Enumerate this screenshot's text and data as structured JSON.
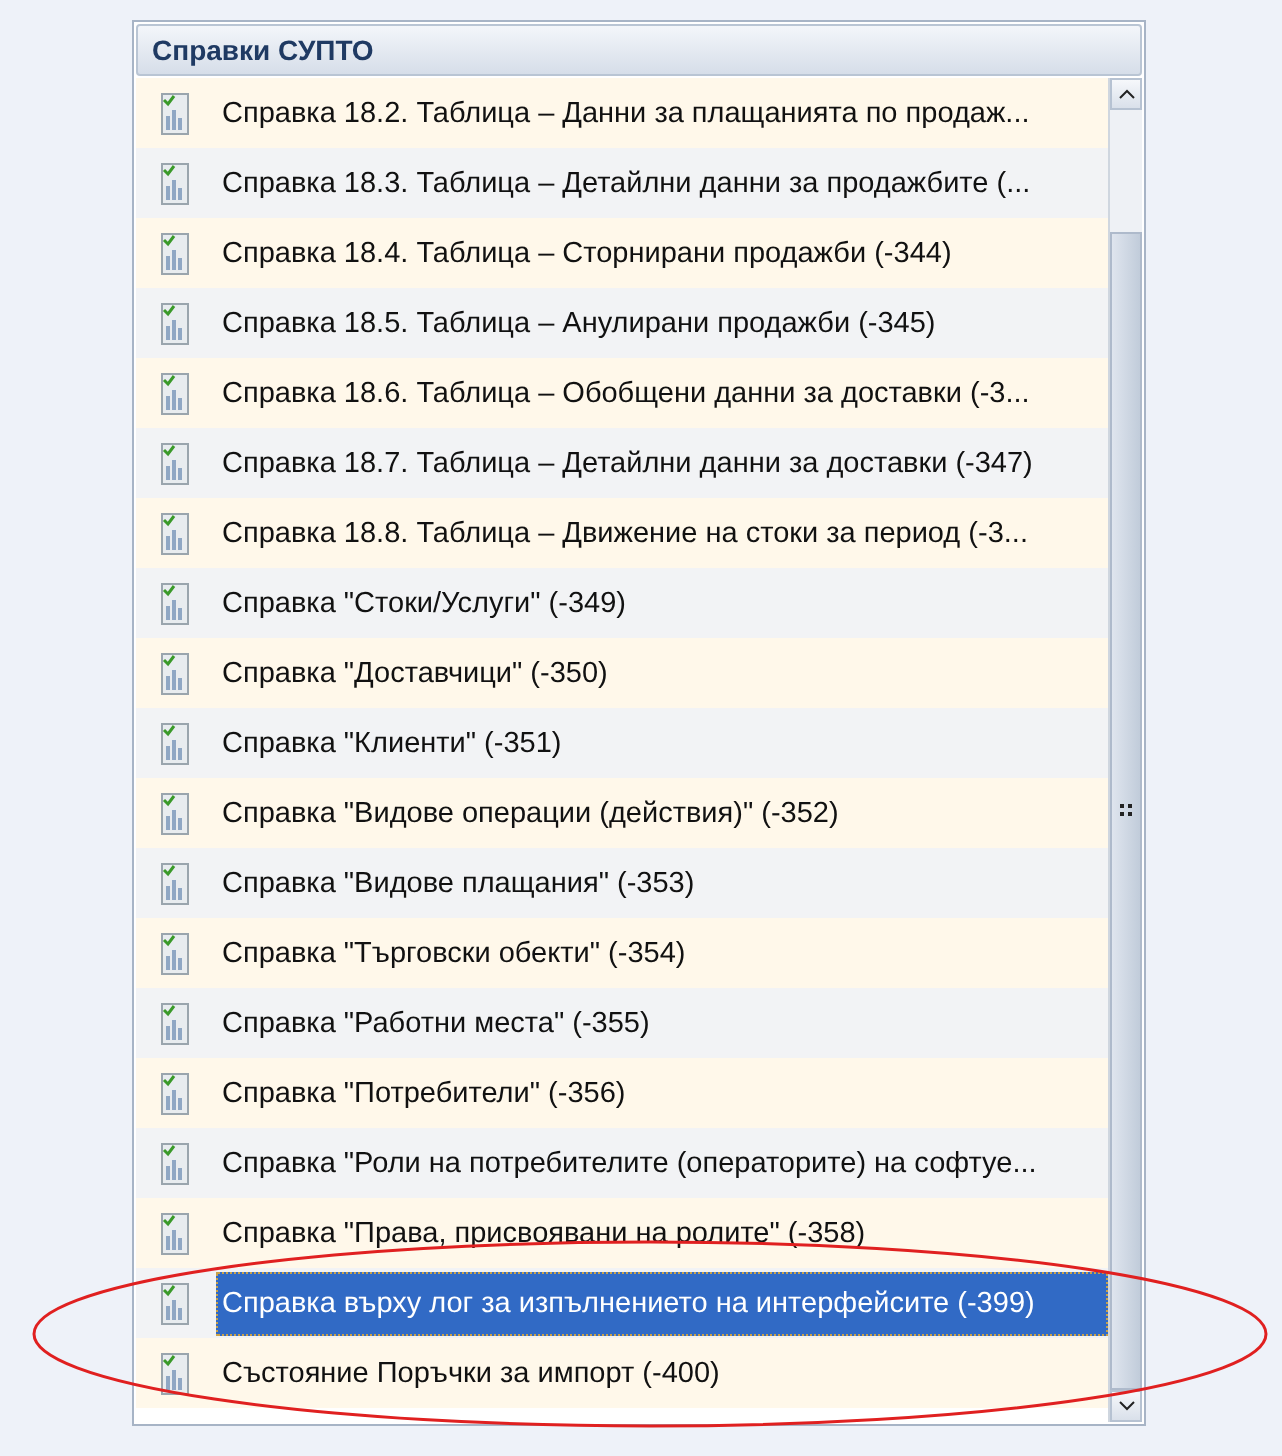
{
  "panel": {
    "title": "Справки СУПТО"
  },
  "items": [
    {
      "label": "Справка 18.2. Таблица – Данни за плащанията по продаж...",
      "selected": false
    },
    {
      "label": "Справка 18.3. Таблица – Детайлни данни за продажбите (...",
      "selected": false
    },
    {
      "label": "Справка 18.4. Таблица – Сторнирани продажби (-344)",
      "selected": false
    },
    {
      "label": "Справка 18.5. Таблица – Анулирани продажби (-345)",
      "selected": false
    },
    {
      "label": "Справка 18.6. Таблица – Обобщени данни за доставки (-3...",
      "selected": false
    },
    {
      "label": "Справка 18.7. Таблица – Детайлни данни за доставки (-347)",
      "selected": false
    },
    {
      "label": "Справка 18.8. Таблица – Движение на стоки за период (-3...",
      "selected": false
    },
    {
      "label": "Справка \"Стоки/Услуги\" (-349)",
      "selected": false
    },
    {
      "label": "Справка \"Доставчици\" (-350)",
      "selected": false
    },
    {
      "label": "Справка \"Клиенти\" (-351)",
      "selected": false
    },
    {
      "label": "Справка \"Видове операции (действия)\" (-352)",
      "selected": false
    },
    {
      "label": "Справка \"Видове плащания\" (-353)",
      "selected": false
    },
    {
      "label": "Справка \"Търговски обекти\" (-354)",
      "selected": false
    },
    {
      "label": "Справка \"Работни места\" (-355)",
      "selected": false
    },
    {
      "label": "Справка \"Потребители\" (-356)",
      "selected": false
    },
    {
      "label": "Справка \"Роли на потребителите (операторите) на софтуе...",
      "selected": false
    },
    {
      "label": "Справка \"Права, присвоявани на ролите\" (-358)",
      "selected": false
    },
    {
      "label": "Справка върху лог за изпълнението на интерфейсите (-399)",
      "selected": true
    },
    {
      "label": "Състояние Поръчки за импорт (-400)",
      "selected": false
    }
  ]
}
